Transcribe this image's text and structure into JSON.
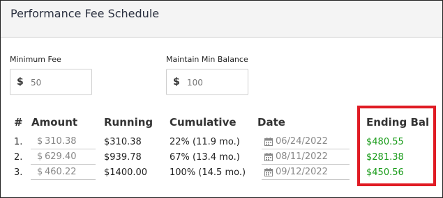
{
  "header": {
    "title": "Performance Fee Schedule"
  },
  "fields": {
    "minimum_fee": {
      "label": "Minimum Fee",
      "currency": "$",
      "value": "50"
    },
    "maintain_min_balance": {
      "label": "Maintain Min Balance",
      "currency": "$",
      "value": "100"
    }
  },
  "table": {
    "columns": [
      "#",
      "Amount",
      "Running",
      "Cumulative",
      "Date",
      "Ending Bal"
    ],
    "rows": [
      {
        "num": "1.",
        "currency": "$",
        "amount": "310.38",
        "running": "$310.38",
        "cumulative": "22% (11.9 mo.)",
        "date": "06/24/2022",
        "ending_bal": "$480.55"
      },
      {
        "num": "2.",
        "currency": "$",
        "amount": "629.40",
        "running": "$939.78",
        "cumulative": "67% (13.4 mo.)",
        "date": "08/11/2022",
        "ending_bal": "$281.38"
      },
      {
        "num": "3.",
        "currency": "$",
        "amount": "460.22",
        "running": "$1400.00",
        "cumulative": "100% (14.5 mo.)",
        "date": "09/12/2022",
        "ending_bal": "$450.56"
      }
    ]
  },
  "colors": {
    "ending_bal": "#1a9c1a",
    "highlight": "#e01b24"
  },
  "icons": {
    "date": "calendar-icon"
  }
}
